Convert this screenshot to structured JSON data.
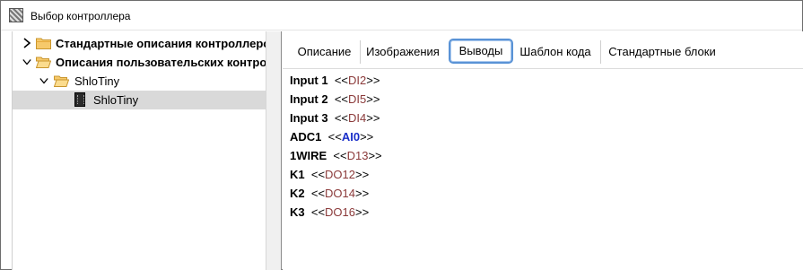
{
  "window": {
    "title": "Выбор контроллера"
  },
  "tree": {
    "items": [
      {
        "label": "Стандартные описания контроллеров",
        "expanded": false,
        "bold": true
      },
      {
        "label": "Описания пользовательских контроллеров",
        "expanded": true,
        "bold": true
      },
      {
        "label": "ShloTiny",
        "expanded": true,
        "bold": false
      },
      {
        "label": "ShloTiny",
        "selected": true,
        "bold": false
      }
    ]
  },
  "tabs": [
    {
      "label": "Описание",
      "active": false
    },
    {
      "label": "Изображения",
      "active": false
    },
    {
      "label": "Выводы",
      "active": true
    },
    {
      "label": "Шаблон кода",
      "active": false
    },
    {
      "label": "Стандартные блоки",
      "active": false
    }
  ],
  "pins": [
    {
      "name": "Input 1",
      "ref": "DI2",
      "analog": false
    },
    {
      "name": "Input 2",
      "ref": "DI5",
      "analog": false
    },
    {
      "name": "Input 3",
      "ref": "DI4",
      "analog": false
    },
    {
      "name": "ADC1",
      "ref": "AI0",
      "analog": true
    },
    {
      "name": "1WIRE",
      "ref": "D13",
      "analog": false
    },
    {
      "name": "K1",
      "ref": "DO12",
      "analog": false
    },
    {
      "name": "K2",
      "ref": "DO14",
      "analog": false
    },
    {
      "name": "K3",
      "ref": "DO16",
      "analog": false
    }
  ],
  "pin_open": "<<",
  "pin_close": ">>",
  "colors": {
    "digital_ref": "#8b3a3a",
    "analog_ref": "#1a2fc9",
    "active_tab_border": "#5a93d6",
    "selected_row": "#d9d9d9"
  },
  "icons": {
    "app": "controller-app-icon",
    "folder": "folder-icon",
    "chip": "chip-icon",
    "collapsed": "chevron-right-icon",
    "expanded": "chevron-down-icon"
  }
}
